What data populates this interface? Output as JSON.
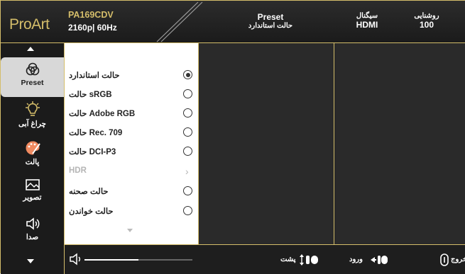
{
  "header": {
    "logo": "ProArt",
    "model": "PA169CDV",
    "resolution": "2160p| 60Hz",
    "preset_label": "Preset",
    "preset_value": "حالت استاندارد",
    "signal_label": "سیگنال",
    "signal_value": "HDMI",
    "brightness_label": "روشنایی",
    "brightness_value": "100"
  },
  "sidebar": {
    "items": [
      {
        "label": "Preset",
        "icon": "color-circles-icon"
      },
      {
        "label": "چراغ آبی",
        "icon": "blue-light-icon"
      },
      {
        "label": "پالت",
        "icon": "palette-icon"
      },
      {
        "label": "تصویر",
        "icon": "image-icon"
      },
      {
        "label": "صدا",
        "icon": "speaker-icon"
      }
    ]
  },
  "menu": {
    "options": [
      {
        "label": "حالت استاندارد",
        "selected": true
      },
      {
        "label": "حالت sRGB",
        "selected": false
      },
      {
        "label": "حالت Adobe RGB",
        "selected": false
      },
      {
        "label": "حالت Rec. 709",
        "selected": false
      },
      {
        "label": "حالت DCI-P3",
        "selected": false
      },
      {
        "label": "HDR",
        "disabled": true
      },
      {
        "label": "حالت صحنه",
        "selected": false
      },
      {
        "label": "حالت خواندن",
        "selected": false
      }
    ]
  },
  "footer": {
    "volume_level": 0.5,
    "back_label": "پشت",
    "enter_label": "ورود",
    "exit_label": "خروج"
  },
  "colors": {
    "accent": "#d4bd6a",
    "background": "#202020",
    "panel": "#ffffff"
  }
}
